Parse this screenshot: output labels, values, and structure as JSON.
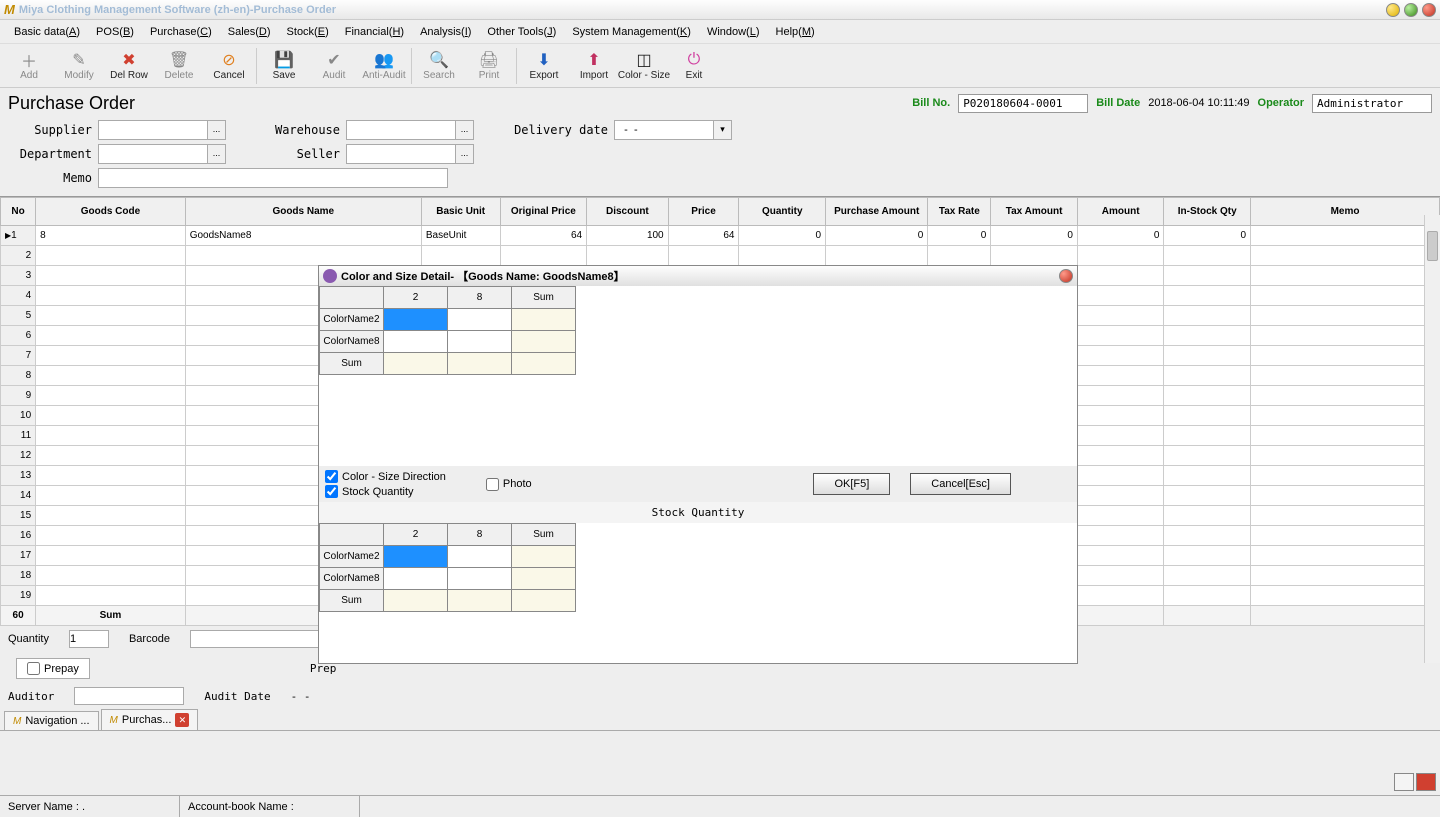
{
  "window": {
    "title": "Miya Clothing Management Software (zh-en)-Purchase Order",
    "logo": "M"
  },
  "menu": [
    "Basic data(A)",
    "POS(B)",
    "Purchase(C)",
    "Sales(D)",
    "Stock(E)",
    "Financial(H)",
    "Analysis(I)",
    "Other Tools(J)",
    "System Management(K)",
    "Window(L)",
    "Help(M)"
  ],
  "toolbar": [
    {
      "label": "Add",
      "icon": "＋",
      "active": false
    },
    {
      "label": "Modify",
      "icon": "✎",
      "active": false
    },
    {
      "label": "Del Row",
      "icon": "✖",
      "active": true,
      "red": true
    },
    {
      "label": "Delete",
      "icon": "🗑",
      "active": false
    },
    {
      "label": "Cancel",
      "icon": "⊘",
      "active": true,
      "orange": true
    },
    {
      "sep": true
    },
    {
      "label": "Save",
      "icon": "💾",
      "active": true,
      "blue": true
    },
    {
      "label": "Audit",
      "icon": "✔",
      "active": false
    },
    {
      "label": "Anti-Audit",
      "icon": "👥",
      "active": false
    },
    {
      "sep": true
    },
    {
      "label": "Search",
      "icon": "🔍",
      "active": false
    },
    {
      "label": "Print",
      "icon": "🖨",
      "active": false
    },
    {
      "sep": true
    },
    {
      "label": "Export",
      "icon": "⬇",
      "active": true,
      "blue": true
    },
    {
      "label": "Import",
      "icon": "⬆",
      "active": true,
      "red2": true
    },
    {
      "label": "Color - Size",
      "icon": "◫",
      "active": true
    },
    {
      "label": "Exit",
      "icon": "⏻",
      "active": true,
      "pink": true
    }
  ],
  "bill": {
    "heading": "Purchase Order",
    "no_label": "Bill No.",
    "no": "P020180604-0001",
    "date_label": "Bill Date",
    "date": "2018-06-04 10:11:49",
    "op_label": "Operator",
    "op": "Administrator"
  },
  "form": {
    "supplier": "Supplier",
    "warehouse": "Warehouse",
    "delivery": "Delivery date",
    "delivery_val": "   -  -",
    "department": "Department",
    "seller": "Seller",
    "memo": "Memo"
  },
  "grid": {
    "cols": [
      "No",
      "Goods Code",
      "Goods Name",
      "Basic Unit",
      "Original Price",
      "Discount",
      "Price",
      "Quantity",
      "Purchase Amount",
      "Tax Rate",
      "Tax Amount",
      "Amount",
      "In-Stock Qty",
      "Memo"
    ],
    "row1": {
      "no": "1",
      "code": "8",
      "name": "GoodsName8",
      "unit": "BaseUnit",
      "oprice": "64",
      "disc": "100",
      "price": "64",
      "qty": "0",
      "pamt": "0",
      "trate": "0",
      "tamt": "0",
      "amt": "0",
      "instock": "0",
      "memo": ""
    },
    "sum_label": "Sum",
    "last_row": "60"
  },
  "bottom": {
    "qty_label": "Quantity",
    "qty": "1",
    "barcode_label": "Barcode"
  },
  "prepay": {
    "label": "Prepay",
    "prep": "Prep"
  },
  "audit": {
    "auditor": "Auditor",
    "date": "Audit Date",
    "date_val": "   -  -"
  },
  "tabs": {
    "nav": "Navigation ...",
    "purch": "Purchas..."
  },
  "status": {
    "server": "Server Name : .",
    "book": "Account-book Name :"
  },
  "dialog": {
    "title": "Color and Size Detail- 【Goods Name: GoodsName8】",
    "sizes": [
      "2",
      "8",
      "Sum"
    ],
    "colors": [
      "ColorName2",
      "ColorName8",
      "Sum"
    ],
    "chk_dir": "Color - Size Direction",
    "chk_stock": "Stock Quantity",
    "chk_photo": "Photo",
    "ok": "OK[F5]",
    "cancel": "Cancel[Esc]",
    "sub": "Stock Quantity"
  }
}
